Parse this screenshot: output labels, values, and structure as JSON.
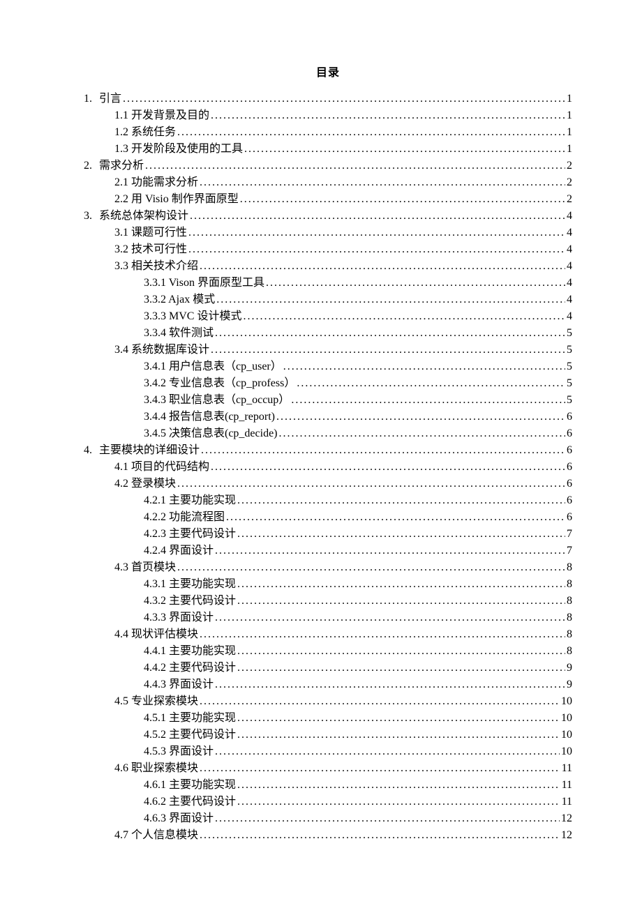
{
  "title": "目录",
  "toc": [
    {
      "level": 0,
      "marker": "1.",
      "label": "引言",
      "page": "1"
    },
    {
      "level": 1,
      "marker": "",
      "label": "1.1 开发背景及目的",
      "page": "1"
    },
    {
      "level": 1,
      "marker": "",
      "label": "1.2 系统任务",
      "page": "1"
    },
    {
      "level": 1,
      "marker": "",
      "label": "1.3 开发阶段及使用的工具",
      "page": "1"
    },
    {
      "level": 0,
      "marker": "2.",
      "label": "需求分析",
      "page": "2"
    },
    {
      "level": 1,
      "marker": "",
      "label": "2.1 功能需求分析",
      "page": "2"
    },
    {
      "level": 1,
      "marker": "",
      "label": "2.2 用 Visio 制作界面原型",
      "page": "2"
    },
    {
      "level": 0,
      "marker": "3.",
      "label": "系统总体架构设计",
      "page": "4"
    },
    {
      "level": 1,
      "marker": "",
      "label": "3.1 课题可行性",
      "page": "4"
    },
    {
      "level": 1,
      "marker": "",
      "label": "3.2 技术可行性",
      "page": "4"
    },
    {
      "level": 1,
      "marker": "",
      "label": "3.3 相关技术介绍",
      "page": "4"
    },
    {
      "level": 2,
      "marker": "",
      "label": "3.3.1 Vison 界面原型工具",
      "page": "4"
    },
    {
      "level": 2,
      "marker": "",
      "label": "3.3.2 Ajax 模式",
      "page": "4"
    },
    {
      "level": 2,
      "marker": "",
      "label": "3.3.3 MVC 设计模式",
      "page": "4"
    },
    {
      "level": 2,
      "marker": "",
      "label": "3.3.4 软件测试",
      "page": "5"
    },
    {
      "level": 1,
      "marker": "",
      "label": "3.4 系统数据库设计",
      "page": "5"
    },
    {
      "level": 2,
      "marker": "",
      "label": "3.4.1 用户信息表（cp_user）",
      "page": "5"
    },
    {
      "level": 2,
      "marker": "",
      "label": "3.4.2 专业信息表（cp_profess）",
      "page": "5"
    },
    {
      "level": 2,
      "marker": "",
      "label": "3.4.3 职业信息表（cp_occup）",
      "page": "5"
    },
    {
      "level": 2,
      "marker": "",
      "label": "3.4.4 报告信息表(cp_report)",
      "page": "6"
    },
    {
      "level": 2,
      "marker": "",
      "label": "3.4.5 决策信息表(cp_decide)",
      "page": "6"
    },
    {
      "level": 0,
      "marker": "4.",
      "label": "主要模块的详细设计",
      "page": "6"
    },
    {
      "level": 1,
      "marker": "",
      "label": "4.1 项目的代码结构",
      "page": "6"
    },
    {
      "level": 1,
      "marker": "",
      "label": "4.2 登录模块",
      "page": "6"
    },
    {
      "level": 2,
      "marker": "",
      "label": "4.2.1 主要功能实现",
      "page": "6"
    },
    {
      "level": 2,
      "marker": "",
      "label": "4.2.2 功能流程图",
      "page": "6"
    },
    {
      "level": 2,
      "marker": "",
      "label": "4.2.3 主要代码设计",
      "page": "7"
    },
    {
      "level": 2,
      "marker": "",
      "label": "4.2.4 界面设计",
      "page": "7"
    },
    {
      "level": 1,
      "marker": "",
      "label": "4.3 首页模块",
      "page": "8"
    },
    {
      "level": 2,
      "marker": "",
      "label": "4.3.1 主要功能实现",
      "page": "8"
    },
    {
      "level": 2,
      "marker": "",
      "label": "4.3.2 主要代码设计",
      "page": "8"
    },
    {
      "level": 2,
      "marker": "",
      "label": "4.3.3 界面设计",
      "page": "8"
    },
    {
      "level": 1,
      "marker": "",
      "label": "4.4 现状评估模块",
      "page": "8"
    },
    {
      "level": 2,
      "marker": "",
      "label": "4.4.1 主要功能实现",
      "page": "8"
    },
    {
      "level": 2,
      "marker": "",
      "label": "4.4.2 主要代码设计",
      "page": "9"
    },
    {
      "level": 2,
      "marker": "",
      "label": "4.4.3 界面设计",
      "page": "9"
    },
    {
      "level": 1,
      "marker": "",
      "label": "4.5 专业探索模块",
      "page": "10"
    },
    {
      "level": 2,
      "marker": "",
      "label": "4.5.1 主要功能实现",
      "page": "10"
    },
    {
      "level": 2,
      "marker": "",
      "label": "4.5.2 主要代码设计",
      "page": "10"
    },
    {
      "level": 2,
      "marker": "",
      "label": "4.5.3 界面设计",
      "page": "10"
    },
    {
      "level": 1,
      "marker": "",
      "label": "4.6 职业探索模块",
      "page": "11"
    },
    {
      "level": 2,
      "marker": "",
      "label": "4.6.1 主要功能实现",
      "page": "11"
    },
    {
      "level": 2,
      "marker": "",
      "label": "4.6.2 主要代码设计",
      "page": "11"
    },
    {
      "level": 2,
      "marker": "",
      "label": "4.6.3 界面设计",
      "page": "12"
    },
    {
      "level": 1,
      "marker": "",
      "label": "4.7 个人信息模块",
      "page": "12"
    }
  ]
}
